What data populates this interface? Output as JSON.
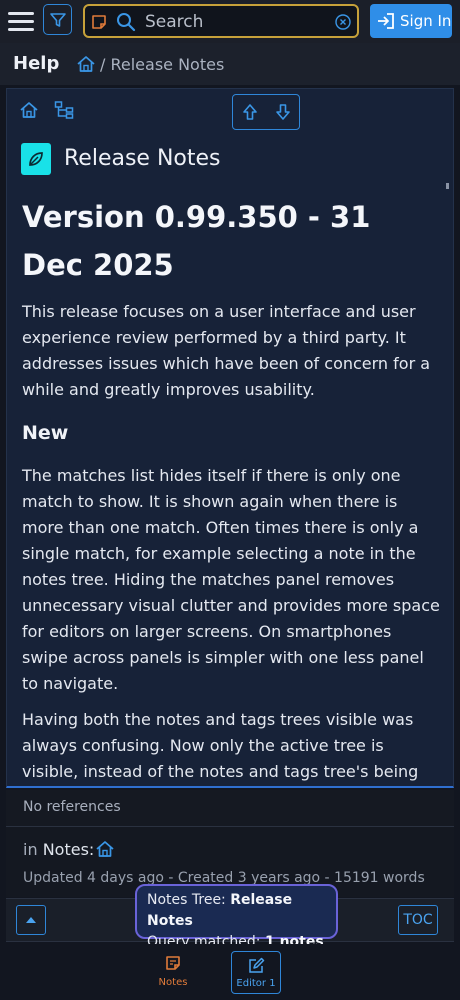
{
  "header": {
    "search_placeholder": "Search",
    "signin_label": "Sign In"
  },
  "breadcrumb": {
    "title": "Help",
    "path": "/ Release Notes"
  },
  "note": {
    "title": "Release Notes",
    "heading": "Version 0.99.350 - 31 Dec 2025",
    "intro": "This release focuses on a user interface and user experience review performed by a third party. It addresses issues which have been of concern for a while and greatly improves usability.",
    "section_new": "New",
    "para1": "The matches list hides itself if there is only one match to show.  It is shown again when there is more than one match. Often times there is only a single match, for example selecting a note in the notes tree. Hiding the matches panel removes unnecessary visual clutter and provides more space for editors on larger screens. On smartphones swipe across panels is simpler with one less panel to navigate.",
    "para2": "Having both the notes and tags trees visible was always confusing. Now only the active tree is visible, instead of the notes and tags tree's being beside each other. This makes it obvious which tree is active and"
  },
  "references": {
    "text": "No references"
  },
  "meta": {
    "in_prefix": "in",
    "in_label": "Notes:",
    "updated": "Updated 4 days ago - Created 3 years ago - 15191 words"
  },
  "toast": {
    "line1_label": "Notes Tree:",
    "line1_value": "Release Notes",
    "line2_label": "Query matched:",
    "line2_value": "1 notes"
  },
  "toc_label": "TOC",
  "tabs": {
    "notes_label": "Notes",
    "editor_label": "Editor 1"
  },
  "colors": {
    "accent_blue": "#2f8ee8",
    "search_border": "#c6a13a",
    "note_icon_bg": "#19e1e8",
    "notes_tab": "#e07b3a",
    "toast_border": "#6a63d8"
  }
}
